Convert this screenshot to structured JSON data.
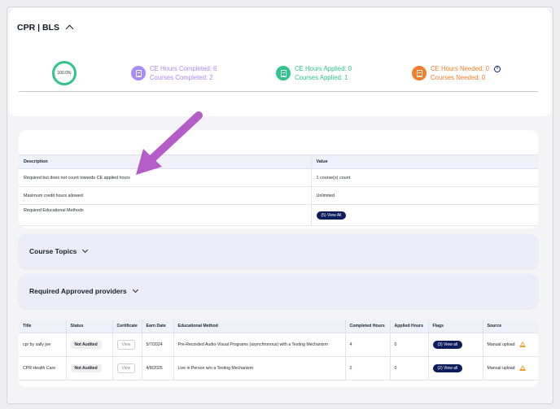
{
  "section": {
    "title": "CPR | BLS"
  },
  "progress": {
    "percent_label": "100.0%",
    "fraction": 1.0
  },
  "stats": {
    "completed": {
      "hours": "CE Hours Completed: 6",
      "courses": "Courses Completed: 2",
      "color": "#a78bfa"
    },
    "applied": {
      "hours": "CE Hours Applied: 0",
      "courses": "Courses Applied: 1",
      "color": "#2ec48b"
    },
    "needed": {
      "hours": "CE Hours Needed: 0",
      "courses": "Courses Needed: 0",
      "color": "#f57c2a"
    }
  },
  "requirements": {
    "headers": {
      "description": "Description",
      "value": "Value"
    },
    "rows": [
      {
        "description": "Required but does not count towards CE applied hours",
        "value": "1 course(s) count"
      },
      {
        "description": "Maximum credit hours allowed",
        "value": "Unlimited"
      },
      {
        "description": "Required Educational Methods",
        "value": "(5) View All"
      }
    ]
  },
  "accordions": {
    "course_topics": "Course Topics",
    "approved_providers": "Required Approved providers"
  },
  "courses": {
    "headers": [
      "Title",
      "Status",
      "Certificate",
      "Earn Date",
      "Educational Method",
      "Completed Hours",
      "Applied Hours",
      "Flags",
      "Source"
    ],
    "rows": [
      {
        "title": "cpr by sally joe",
        "status": "Not Audited",
        "certificate": "View",
        "earn_date": "5/7/2024",
        "method": "Pre-Recorded Audio-Visual Programs (asynchronous) with a Testing Mechanism",
        "completed": "4",
        "applied": "0",
        "flags": "(3) View all",
        "source": "Manual upload"
      },
      {
        "title": "CPR Health Care",
        "status": "Not Audited",
        "certificate": "View",
        "earn_date": "4/8/2025",
        "method": "Live in Person w/o a Testing Mechanism",
        "completed": "2",
        "applied": "0",
        "flags": "(2) View all",
        "source": "Manual upload"
      }
    ]
  },
  "colors": {
    "accent_navy": "#0d1c5c",
    "annotation_arrow": "#b45cc8",
    "warning": "#f0a020"
  },
  "icons": {
    "stat_icon": "document-icon",
    "info": "info-icon",
    "flag_warning": "warning-icon"
  }
}
